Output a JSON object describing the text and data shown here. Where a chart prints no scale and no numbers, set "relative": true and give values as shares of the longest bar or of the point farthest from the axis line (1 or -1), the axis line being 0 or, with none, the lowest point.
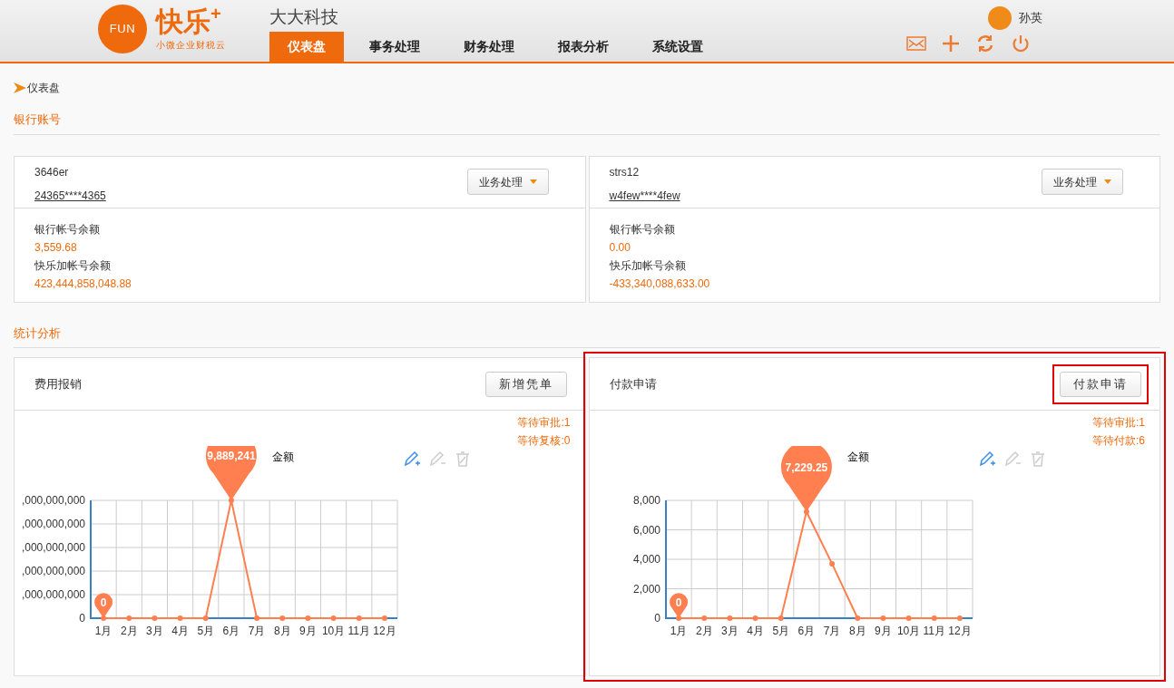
{
  "header": {
    "logo_text": "FUN",
    "brand": "快乐",
    "brand_plus": "+",
    "slogan": "小微企业财税云",
    "company": "大大科技",
    "user": "孙英",
    "nav": [
      {
        "label": "仪表盘",
        "selected": true
      },
      {
        "label": "事务处理",
        "selected": false
      },
      {
        "label": "财务处理",
        "selected": false
      },
      {
        "label": "报表分析",
        "selected": false
      },
      {
        "label": "系统设置",
        "selected": false
      }
    ]
  },
  "breadcrumb": "仪表盘",
  "bank_section": {
    "title": "银行账号",
    "accounts": [
      {
        "name": "3646er",
        "number": "24365****4365",
        "button": "业务处理",
        "balance_label": "银行帐号余额",
        "balance": "3,559.68",
        "plus_label": "快乐加帐号余额",
        "plus_balance": "423,444,858,048.88"
      },
      {
        "name": "strs12",
        "number": "w4few****4few",
        "button": "业务处理",
        "balance_label": "银行帐号余额",
        "balance": "0.00",
        "plus_label": "快乐加帐号余额",
        "plus_balance": "-433,340,088,633.00"
      }
    ]
  },
  "stats_section": {
    "title": "统计分析",
    "panels": [
      {
        "title": "费用报销",
        "button": "新增凭单",
        "highlighted": false,
        "button_highlighted": false,
        "status": [
          "等待审批:1",
          "等待复核:0"
        ],
        "y_axis_labels": [
          ",000,000,000",
          ",000,000,000",
          ",000,000,000",
          ",000,000,000",
          ",000,000,000",
          "0"
        ],
        "chart_data": {
          "type": "line",
          "relative": true,
          "grid": true,
          "categories": [
            "1月",
            "2月",
            "3月",
            "4月",
            "5月",
            "6月",
            "7月",
            "8月",
            "9月",
            "10月",
            "11月",
            "12月"
          ],
          "series": [
            {
              "name": "金额",
              "color": "#ff7f50",
              "marker": "circle",
              "values": [
                0,
                0,
                0,
                0,
                0,
                1,
                0,
                0,
                0,
                0,
                0,
                0
              ]
            }
          ],
          "ylim": [
            0,
            1
          ],
          "annotations": [
            "9,889,241",
            "0"
          ]
        }
      },
      {
        "title": "付款申请",
        "button": "付款申请",
        "highlighted": true,
        "button_highlighted": true,
        "status": [
          "等待审批:1",
          "等待付款:6"
        ],
        "chart_data": {
          "type": "line",
          "grid": true,
          "categories": [
            "1月",
            "2月",
            "3月",
            "4月",
            "5月",
            "6月",
            "7月",
            "8月",
            "9月",
            "10月",
            "11月",
            "12月"
          ],
          "series": [
            {
              "name": "金额",
              "color": "#ff7f50",
              "marker": "circle",
              "values": [
                0,
                0,
                0,
                0,
                0,
                7229,
                3700,
                0,
                0,
                0,
                0,
                0
              ]
            }
          ],
          "ylim": [
            0,
            8000
          ],
          "yticks": [
            {
              "value": 0,
              "label": "0"
            },
            {
              "value": 2000,
              "label": "2,000"
            },
            {
              "value": 4000,
              "label": "4,000"
            },
            {
              "value": 6000,
              "label": "6,000"
            },
            {
              "value": 8000,
              "label": "8,000"
            }
          ],
          "annotations": [
            "7,229.25",
            "0"
          ]
        }
      }
    ]
  }
}
